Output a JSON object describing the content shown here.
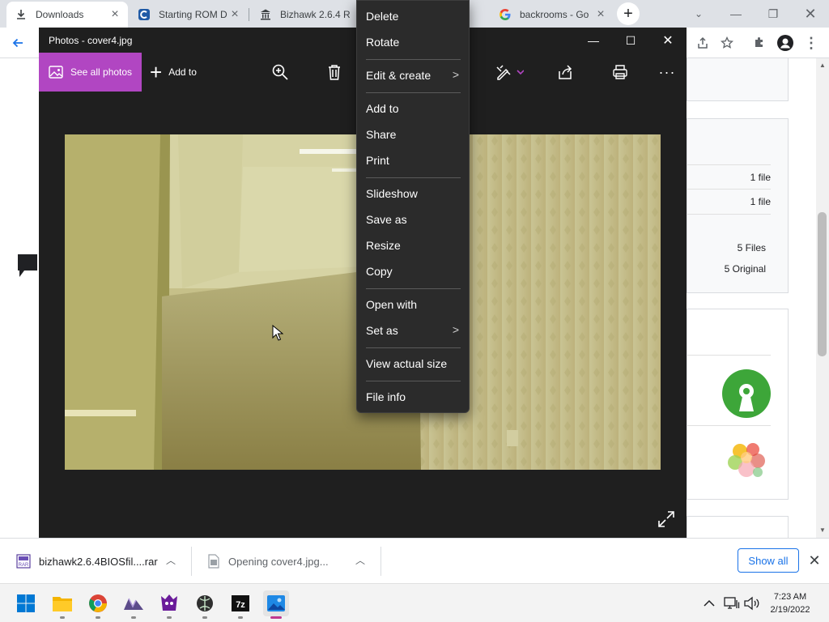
{
  "browser": {
    "tabs": [
      {
        "label": "Downloads",
        "icon": "download-icon"
      },
      {
        "label": "Starting ROM D",
        "icon": "site-c-icon"
      },
      {
        "label": "Bizhawk 2.6.4 R",
        "icon": "archive-building-icon"
      },
      {
        "label": "backrooms - Go",
        "icon": "google-icon"
      }
    ],
    "new_tab": "+"
  },
  "page": {
    "rows": [
      {
        "value": "1 file"
      },
      {
        "value": "1 file"
      }
    ],
    "files_count": "5 Files",
    "original_count": "5 Original"
  },
  "downloads_bar": {
    "items": [
      {
        "label": "bizhawk2.6.4BIOSfil....rar",
        "icon": "rar-file-icon"
      },
      {
        "label": "Opening cover4.jpg...",
        "icon": "image-file-icon"
      }
    ],
    "show_all": "Show all"
  },
  "photos": {
    "title": "Photos - cover4.jpg",
    "see_all": "See all photos",
    "add_to": "Add to",
    "accent": "#b146c2"
  },
  "context_menu": {
    "items": [
      {
        "label": "Delete"
      },
      {
        "label": "Rotate"
      },
      {
        "label": "Edit & create",
        "submenu": true
      },
      {
        "label": "Add to"
      },
      {
        "label": "Share"
      },
      {
        "label": "Print"
      },
      {
        "label": "Slideshow"
      },
      {
        "label": "Save as"
      },
      {
        "label": "Resize"
      },
      {
        "label": "Copy"
      },
      {
        "label": "Open with"
      },
      {
        "label": "Set as",
        "submenu": true
      },
      {
        "label": "View actual size"
      },
      {
        "label": "File info"
      }
    ],
    "submenu_arrow": ">"
  },
  "taskbar": {
    "apps": [
      "windows-start-icon",
      "file-explorer-icon",
      "chrome-icon",
      "app-icon",
      "game-icon",
      "app-icon",
      "7zip-icon",
      "photos-icon"
    ],
    "clock": {
      "time": "7:23 AM",
      "date": "2/19/2022"
    }
  }
}
